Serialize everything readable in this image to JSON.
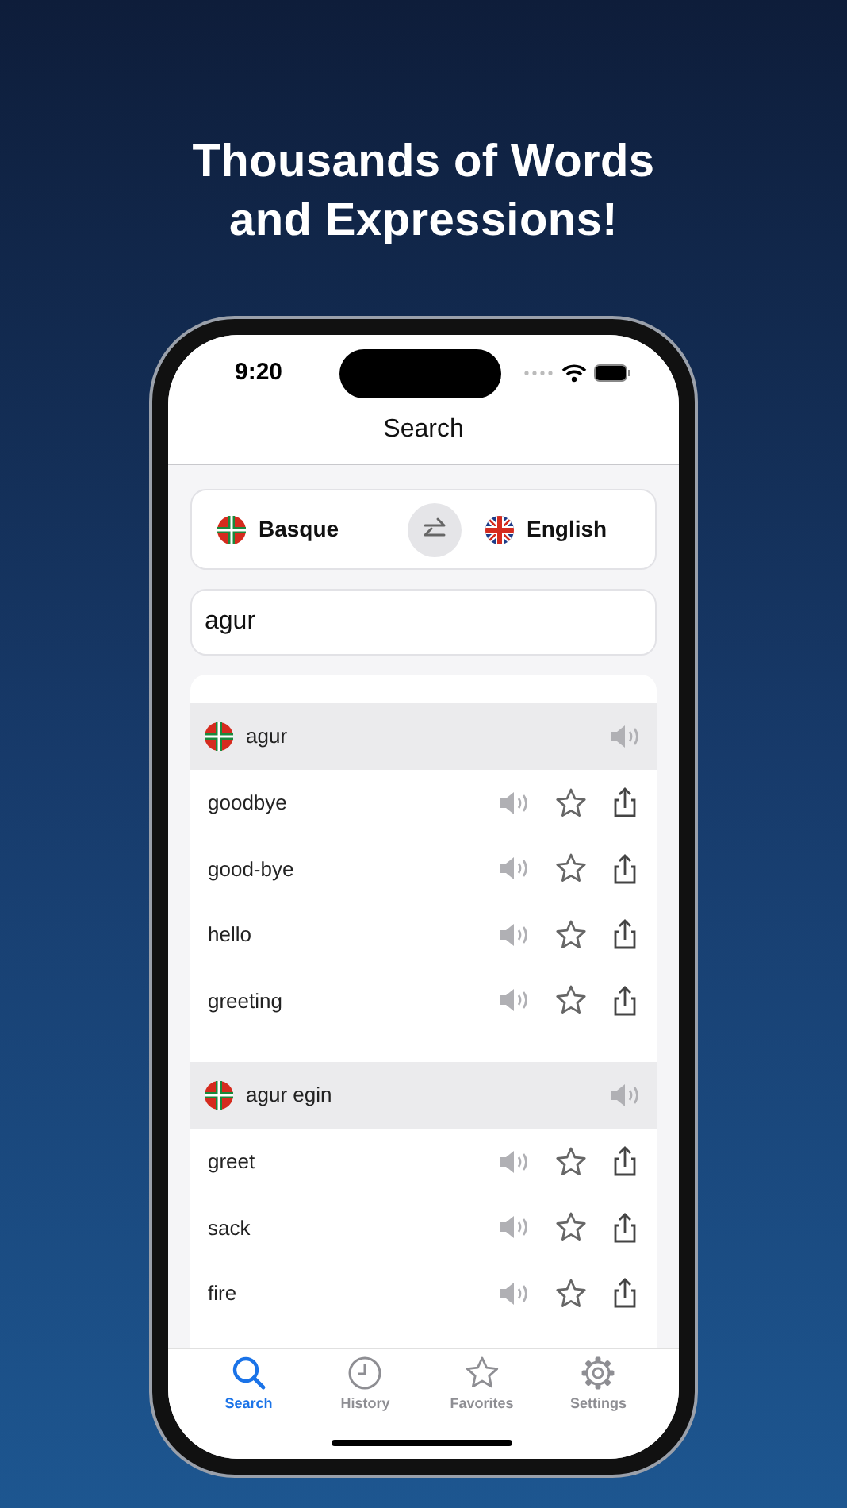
{
  "headline": "Thousands of Words and Expressions!",
  "status_bar": {
    "time": "9:20"
  },
  "nav_title": "Search",
  "languages": {
    "source": "Basque",
    "target": "English"
  },
  "search": {
    "value": "agur"
  },
  "groups": [
    {
      "term": "agur",
      "rows": [
        {
          "text": "goodbye",
          "favorite": false
        },
        {
          "text": "good-bye",
          "favorite": false
        },
        {
          "text": "hello",
          "favorite": false
        },
        {
          "text": "greeting",
          "favorite": false
        }
      ]
    },
    {
      "term": "agur egin",
      "rows": [
        {
          "text": "greet",
          "favorite": false
        },
        {
          "text": "sack",
          "favorite": false
        },
        {
          "text": "fire",
          "favorite": false
        }
      ]
    }
  ],
  "tabs": [
    {
      "kind": "search",
      "label": "Search",
      "selected": true
    },
    {
      "kind": "history",
      "label": "History",
      "selected": false
    },
    {
      "kind": "favorites",
      "label": "Favorites",
      "selected": false
    },
    {
      "kind": "settings",
      "label": "Settings",
      "selected": false
    }
  ]
}
